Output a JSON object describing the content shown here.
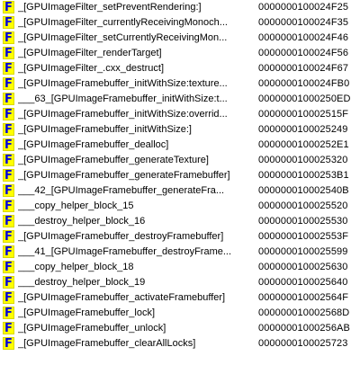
{
  "functions": {
    "icon_letter": "F",
    "icon_name": "function-icon",
    "icon_bg_color": "#ffff00",
    "icon_fg_color": "#0000e0",
    "rows": [
      {
        "name": "_[GPUImageFilter_setPreventRendering:]",
        "address": "0000000100024F25"
      },
      {
        "name": "_[GPUImageFilter_currentlyReceivingMonoch...",
        "address": "0000000100024F35"
      },
      {
        "name": "_[GPUImageFilter_setCurrentlyReceivingMon...",
        "address": "0000000100024F46"
      },
      {
        "name": "_[GPUImageFilter_renderTarget]",
        "address": "0000000100024F56"
      },
      {
        "name": "_[GPUImageFilter_.cxx_destruct]",
        "address": "0000000100024F67"
      },
      {
        "name": "_[GPUImageFramebuffer_initWithSize:texture...",
        "address": "0000000100024FB0"
      },
      {
        "name": "___63_[GPUImageFramebuffer_initWithSize:t...",
        "address": "00000001000250ED"
      },
      {
        "name": "_[GPUImageFramebuffer_initWithSize:overrid...",
        "address": "000000010002515F"
      },
      {
        "name": "_[GPUImageFramebuffer_initWithSize:]",
        "address": "0000000100025249"
      },
      {
        "name": "_[GPUImageFramebuffer_dealloc]",
        "address": "00000001000252E1"
      },
      {
        "name": "_[GPUImageFramebuffer_generateTexture]",
        "address": "0000000100025320"
      },
      {
        "name": "_[GPUImageFramebuffer_generateFramebuffer]",
        "address": "00000001000253B1"
      },
      {
        "name": "___42_[GPUImageFramebuffer_generateFra...",
        "address": "000000010002540B"
      },
      {
        "name": "___copy_helper_block_15",
        "address": "0000000100025520"
      },
      {
        "name": "___destroy_helper_block_16",
        "address": "0000000100025530"
      },
      {
        "name": "_[GPUImageFramebuffer_destroyFramebuffer]",
        "address": "000000010002553F"
      },
      {
        "name": "___41_[GPUImageFramebuffer_destroyFrame...",
        "address": "0000000100025599"
      },
      {
        "name": "___copy_helper_block_18",
        "address": "0000000100025630"
      },
      {
        "name": "___destroy_helper_block_19",
        "address": "0000000100025640"
      },
      {
        "name": "_[GPUImageFramebuffer_activateFramebuffer]",
        "address": "000000010002564F"
      },
      {
        "name": "_[GPUImageFramebuffer_lock]",
        "address": "000000010002568D"
      },
      {
        "name": "_[GPUImageFramebuffer_unlock]",
        "address": "00000001000256AB"
      },
      {
        "name": "_[GPUImageFramebuffer_clearAllLocks]",
        "address": "0000000100025723"
      }
    ]
  }
}
